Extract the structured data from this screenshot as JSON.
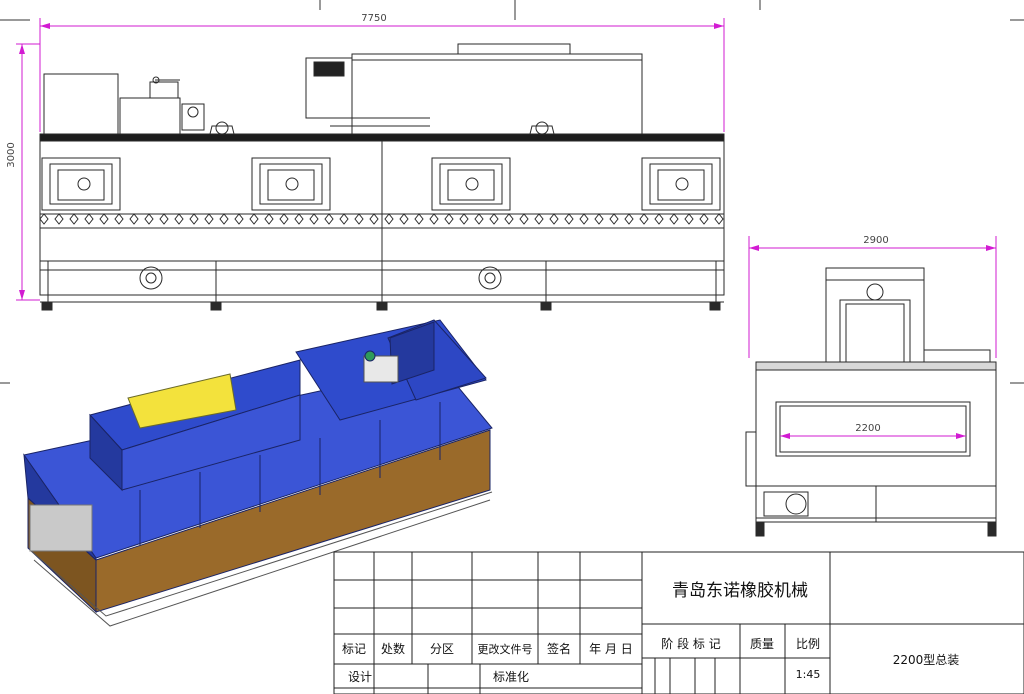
{
  "dimensions": {
    "overall_length": "7750",
    "overall_height": "3000",
    "side_width": "2900",
    "inner_width": "2200"
  },
  "title_block": {
    "company": "青岛东诺橡胶机械",
    "drawing_title": "2200型总装",
    "scale": "1:45",
    "headers": {
      "mark": "标记",
      "count": "处数",
      "zone": "分区",
      "change_doc": "更改文件号",
      "sign": "签名",
      "date": "年 月 日",
      "stage_mark": "阶 段 标 记",
      "weight": "质量",
      "scale_label": "比例"
    },
    "rows": {
      "design": "设计",
      "standardize": "标准化"
    }
  },
  "colors": {
    "line": "#2a2a2a",
    "dimension": "#d21bd2",
    "body_blue": "#3b55d6",
    "body_blue_dark": "#24399e",
    "top_yellow": "#f3e23c",
    "frame_brown": "#9a6a2a"
  }
}
